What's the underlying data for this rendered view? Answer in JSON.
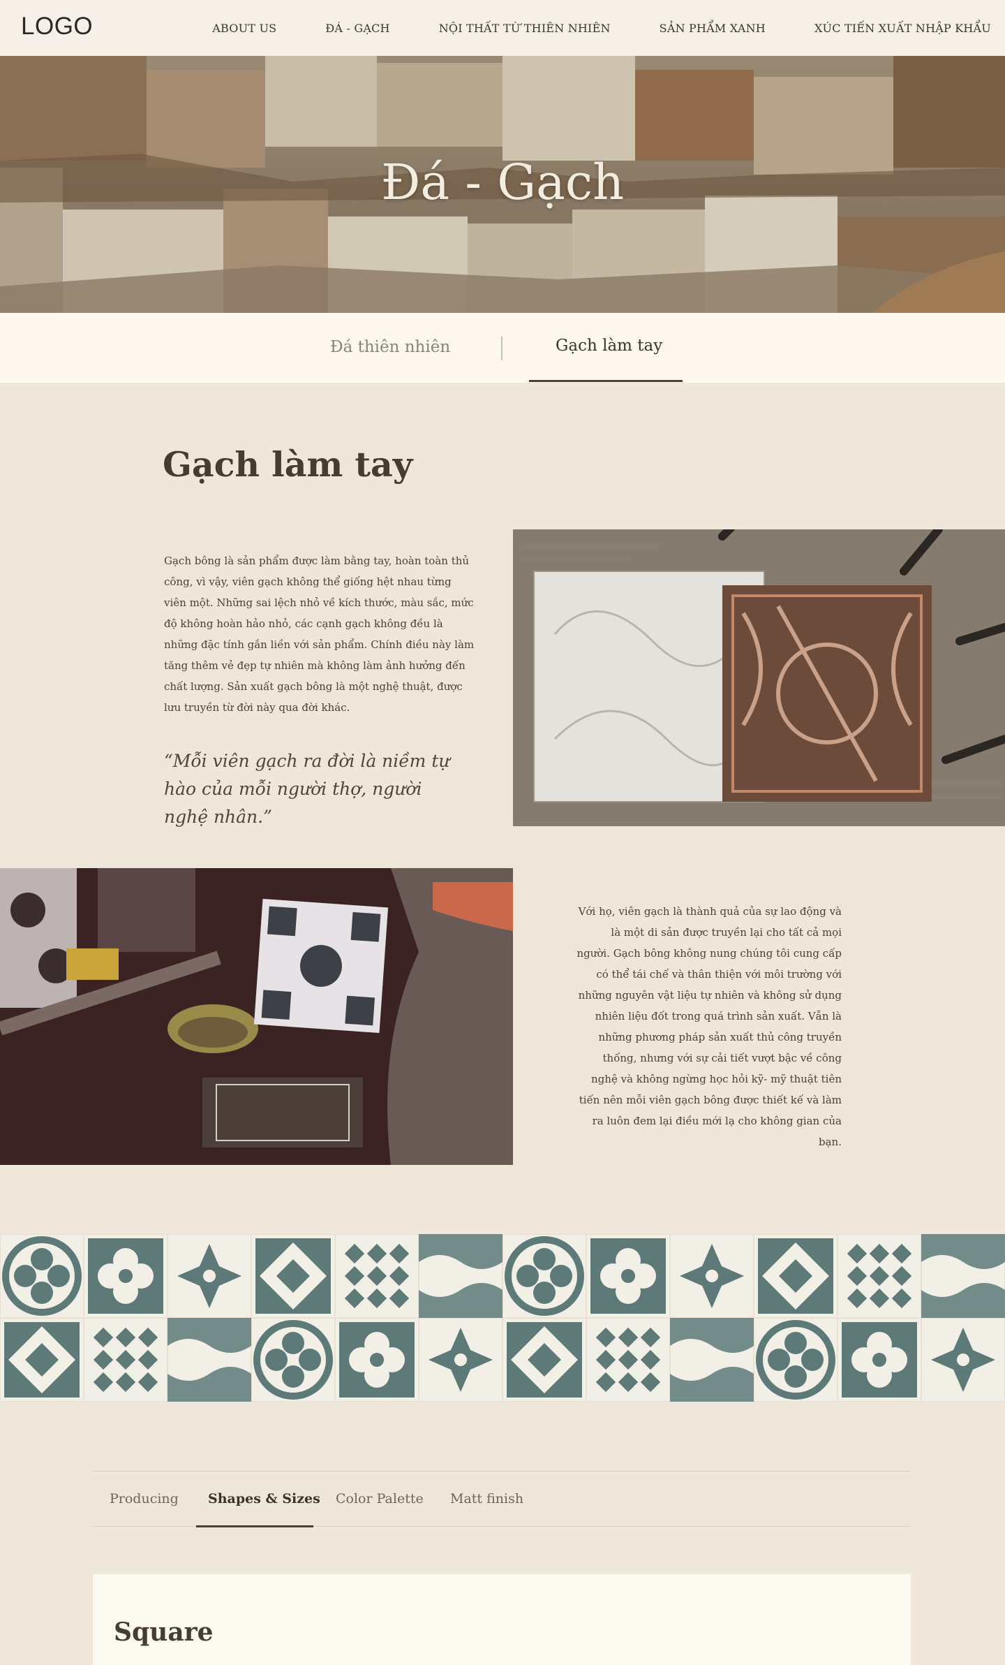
{
  "header": {
    "logo": "LOGO",
    "nav": [
      "ABOUT US",
      "ĐÁ - GẠCH",
      "NỘI THẤT TỪ THIÊN NHIÊN",
      "SẢN PHẨM XANH",
      "XÚC TIẾN XUẤT NHẬP KHẨU"
    ]
  },
  "hero": {
    "title": "Đá - Gạch"
  },
  "category_tabs": {
    "items": [
      "Đá thiên nhiên",
      "Gạch làm tay"
    ],
    "active_index": 1
  },
  "section": {
    "heading": "Gạch làm tay",
    "paragraph1": "Gạch bông là sản phẩm được làm bằng tay, hoàn toàn thủ công, vì vậy, viên gạch không thể giống hệt nhau từng viên một. Những sai lệch nhỏ về kích thước, màu sắc, mức độ không hoàn hảo nhỏ, các cạnh gạch không đều là những đặc tính gắn liền với sản phẩm. Chính điều này làm tăng thêm vẻ đẹp tự nhiên mà không làm ảnh hưởng đến chất lượng. Sản xuất gạch bông là một nghệ thuật, được lưu truyền từ đời này qua đời khác.",
    "quote": "“Mỗi viên gạch ra đời là niềm tự hào của mỗi người thợ, người nghệ nhân.”",
    "paragraph2": "Với họ, viên gạch là thành quả của sự lao động và là một di sản được truyền lại cho tất cả mọi người. Gạch bông không nung chúng tôi cung cấp có thể tái chế và thân thiện với môi trường với những nguyên vật liệu tự nhiên và không sử dụng nhiên liệu đốt trong quá trình sản xuất. Vẫn là những phương pháp sản xuất thủ công truyền thống, nhưng với sự cải tiết vượt bậc về công nghệ và không ngừng học hỏi kỹ- mỹ thuật tiên tiến nên mỗi viên gạch bông được thiết kế và làm ra luôn đem lại điều mới lạ cho không gian của bạn."
  },
  "sub_tabs": {
    "items": [
      "Producing",
      "Shapes & Sizes",
      "Color Palette",
      "Matt finish"
    ],
    "active_index": 1
  },
  "card": {
    "title": "Square"
  },
  "colors": {
    "background": "#efe7da",
    "header": "#f6f1e8",
    "tile_teal": "#5d7a78",
    "tile_light": "#f2efe6",
    "text": "#3d3529"
  }
}
